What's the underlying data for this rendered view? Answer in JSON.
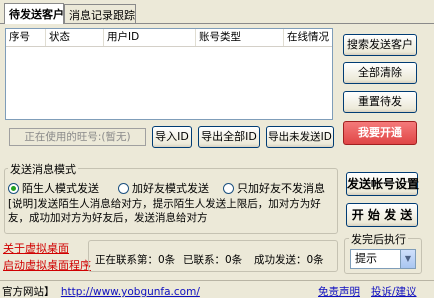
{
  "tabs": [
    {
      "label": "待发送客户",
      "active": true
    },
    {
      "label": "消息记录跟踪",
      "active": false
    }
  ],
  "list": {
    "columns": [
      "序号",
      "状态",
      "用户ID",
      "账号类型",
      "在线情况"
    ]
  },
  "right_buttons": {
    "search": "搜索发送客户",
    "clear": "全部清除",
    "reset": "重置待发",
    "vip": "我要开通"
  },
  "account_field": {
    "placeholder": "正在使用的旺号:(暂无)"
  },
  "io_buttons": {
    "import": "导入ID",
    "export_all": "导出全部ID",
    "export_unsent": "导出未发送ID"
  },
  "mode": {
    "title": "发送消息模式",
    "options": [
      {
        "label": "陌生人模式发送",
        "checked": true
      },
      {
        "label": "加好友模式发送",
        "checked": false
      },
      {
        "label": "只加好友不发消息",
        "checked": false
      }
    ],
    "description": "[说明]发送陌生人消息给对方，提示陌生人发送上限后，加对方为好友，成功加对方为好友后，发送消息给对方"
  },
  "side_actions": {
    "settings": "发送帐号设置",
    "start": "开 始 发 送"
  },
  "desktop_links": {
    "close": "关于虚拟桌面",
    "start": "启动虚拟桌面程序"
  },
  "stats": {
    "contacting": "正在联系第：0条",
    "contacted": "已联系：0条",
    "success": "成功发送：0条"
  },
  "after_send": {
    "label": "发完后执行",
    "selected": "提示"
  },
  "footer": {
    "site_label": "官方网站】",
    "site_url": "http://www.yobgunfa.com/",
    "disclaimer": "免责声明",
    "feedback": "投诉/建议"
  },
  "colors": {
    "background": "#ece9d8",
    "accent_red": "#e04646",
    "link_red": "#d00000",
    "link_blue": "#1010c0",
    "radio_green": "#21a121"
  }
}
